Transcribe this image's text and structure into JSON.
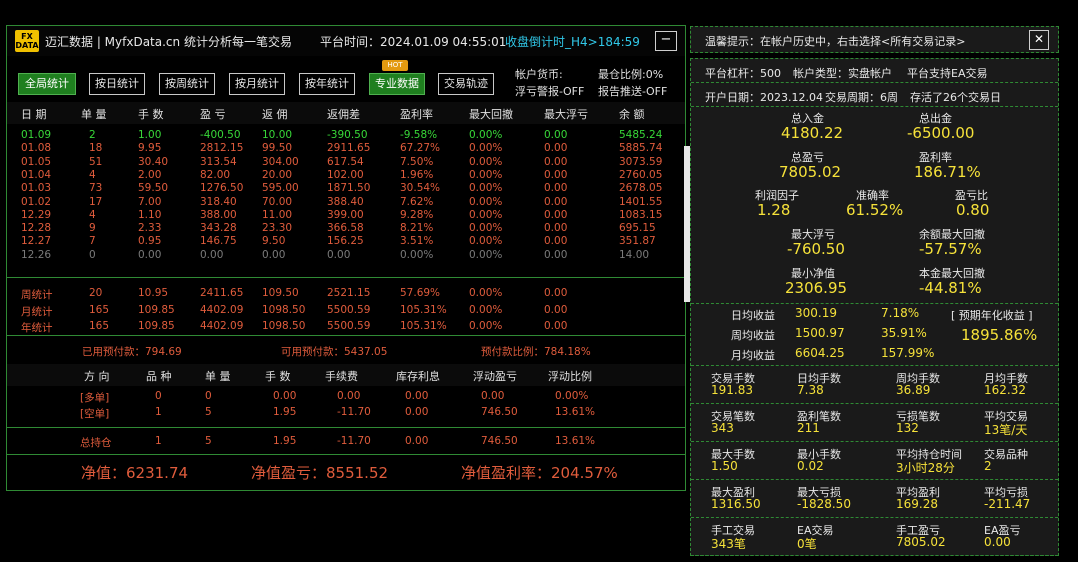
{
  "header": {
    "logo_top": "FX",
    "logo_bottom": "DATA",
    "brand": "迈汇数据 | MyfxData.cn  统计分析每一笔交易",
    "platform_time": "平台时间：2024.01.09 04:55:01",
    "countdown": "收盘倒计时_H4>184:59",
    "minimize": "−"
  },
  "toolbar": {
    "buttons": [
      "全局统计",
      "按日统计",
      "按周统计",
      "按月统计",
      "按年统计",
      "专业数据",
      "交易轨迹"
    ],
    "hot_badge": "HOT",
    "account_currency": "帐户货币:",
    "max_position_ratio": "最仓比例:0%",
    "float_alert": "浮亏警报-OFF",
    "report_push": "报告推送-OFF"
  },
  "table": {
    "columns": [
      "日 期",
      "单 量",
      "手 数",
      "盈 亏",
      "返 佣",
      "返佣差",
      "盈利率",
      "最大回撤",
      "最大浮亏",
      "余 额"
    ],
    "rows": [
      [
        "01.09",
        "2",
        "1.00",
        "-400.50",
        "10.00",
        "-390.50",
        "-9.58%",
        "0.00%",
        "0.00",
        "5485.24"
      ],
      [
        "01.08",
        "18",
        "9.95",
        "2812.15",
        "99.50",
        "2911.65",
        "67.27%",
        "0.00%",
        "0.00",
        "5885.74"
      ],
      [
        "01.05",
        "51",
        "30.40",
        "313.54",
        "304.00",
        "617.54",
        "7.50%",
        "0.00%",
        "0.00",
        "3073.59"
      ],
      [
        "01.04",
        "4",
        "2.00",
        "82.00",
        "20.00",
        "102.00",
        "1.96%",
        "0.00%",
        "0.00",
        "2760.05"
      ],
      [
        "01.03",
        "73",
        "59.50",
        "1276.50",
        "595.00",
        "1871.50",
        "30.54%",
        "0.00%",
        "0.00",
        "2678.05"
      ],
      [
        "01.02",
        "17",
        "7.00",
        "318.40",
        "70.00",
        "388.40",
        "7.62%",
        "0.00%",
        "0.00",
        "1401.55"
      ],
      [
        "12.29",
        "4",
        "1.10",
        "388.00",
        "11.00",
        "399.00",
        "9.28%",
        "0.00%",
        "0.00",
        "1083.15"
      ],
      [
        "12.28",
        "9",
        "2.33",
        "343.28",
        "23.30",
        "366.58",
        "8.21%",
        "0.00%",
        "0.00",
        "695.15"
      ],
      [
        "12.27",
        "7",
        "0.95",
        "146.75",
        "9.50",
        "156.25",
        "3.51%",
        "0.00%",
        "0.00",
        "351.87"
      ],
      [
        "12.26",
        "0",
        "0.00",
        "0.00",
        "0.00",
        "0.00",
        "0.00%",
        "0.00%",
        "0.00",
        "14.00"
      ]
    ],
    "summary": [
      [
        "周统计",
        "20",
        "10.95",
        "2411.65",
        "109.50",
        "2521.15",
        "57.69%",
        "0.00%",
        "0.00"
      ],
      [
        "月统计",
        "165",
        "109.85",
        "4402.09",
        "1098.50",
        "5500.59",
        "105.31%",
        "0.00%",
        "0.00"
      ],
      [
        "年统计",
        "165",
        "109.85",
        "4402.09",
        "1098.50",
        "5500.59",
        "105.31%",
        "0.00%",
        "0.00"
      ]
    ]
  },
  "margin": {
    "used": "已用预付款：794.69",
    "available": "可用预付款：5437.05",
    "ratio": "预付款比例：784.18%"
  },
  "positions": {
    "columns": [
      "方 向",
      "品 种",
      "单 量",
      "手 数",
      "手续费",
      "库存利息",
      "浮动盈亏",
      "浮动比例"
    ],
    "rows": [
      [
        "[多单]",
        "0",
        "0",
        "0.00",
        "0.00",
        "0.00",
        "0.00",
        "0.00%"
      ],
      [
        "[空单]",
        "1",
        "5",
        "1.95",
        "-11.70",
        "0.00",
        "746.50",
        "13.61%"
      ]
    ],
    "total": [
      "总持仓",
      "1",
      "5",
      "1.95",
      "-11.70",
      "0.00",
      "746.50",
      "13.61%"
    ]
  },
  "equity": {
    "net_value": "净值：6231.74",
    "net_profit": "净值盈亏：8551.52",
    "net_rate": "净值盈利率：204.57%"
  },
  "tip": {
    "text": "温馨提示：在帐户历史中，右击选择<所有交易记录>",
    "close": "✕"
  },
  "account": {
    "leverage": "平台杠杆：500",
    "type": "帐户类型：实盘帐户",
    "ea": "平台支持EA交易",
    "open_date": "开户日期：2023.12.04",
    "period": "交易周期：6周",
    "survival": "存活了26个交易日"
  },
  "stats": {
    "deposit_label": "总入金",
    "deposit": "4180.22",
    "withdraw_label": "总出金",
    "withdraw": "-6500.00",
    "pl_label": "总盈亏",
    "pl": "7805.02",
    "rate_label": "盈利率",
    "rate": "186.71%",
    "pf_label": "利润因子",
    "pf": "1.28",
    "acc_label": "准确率",
    "acc": "61.52%",
    "rr_label": "盈亏比",
    "rr": "0.80",
    "maxfl_label": "最大浮亏",
    "maxfl": "-760.50",
    "baldd_label": "余额最大回撤",
    "baldd": "-57.57%",
    "mineq_label": "最小净值",
    "mineq": "2306.95",
    "capdd_label": "本金最大回撤",
    "capdd": "-44.81%"
  },
  "returns": {
    "daily_label": "日均收益",
    "daily": "300.19",
    "daily_pct": "7.18%",
    "weekly_label": "周均收益",
    "weekly": "1500.97",
    "weekly_pct": "35.91%",
    "monthly_label": "月均收益",
    "monthly": "6604.25",
    "monthly_pct": "157.99%",
    "annual_label": "[ 预期年化收益 ]",
    "annual": "1895.86%"
  },
  "grid": [
    [
      [
        "交易手数",
        "191.83"
      ],
      [
        "日均手数",
        "7.38"
      ],
      [
        "周均手数",
        "36.89"
      ],
      [
        "月均手数",
        "162.32"
      ]
    ],
    [
      [
        "交易笔数",
        "343"
      ],
      [
        "盈利笔数",
        "211"
      ],
      [
        "亏损笔数",
        "132"
      ],
      [
        "平均交易",
        "13笔/天"
      ]
    ],
    [
      [
        "最大手数",
        "1.50"
      ],
      [
        "最小手数",
        "0.02"
      ],
      [
        "平均持仓时间",
        "3小时28分"
      ],
      [
        "交易品种",
        "2"
      ]
    ],
    [
      [
        "最大盈利",
        "1316.50"
      ],
      [
        "最大亏损",
        "-1828.50"
      ],
      [
        "平均盈利",
        "169.28"
      ],
      [
        "平均亏损",
        "-211.47"
      ]
    ],
    [
      [
        "手工交易",
        "343笔"
      ],
      [
        "EA交易",
        "0笔"
      ],
      [
        "手工盈亏",
        "7805.02"
      ],
      [
        "EA盈亏",
        "0.00"
      ]
    ]
  ],
  "colors": {
    "accent_green": "#2f8a34",
    "profit_yellow": "#f6e23a",
    "loss_red": "#e05c3c",
    "countdown_cyan": "#31c8e8"
  }
}
